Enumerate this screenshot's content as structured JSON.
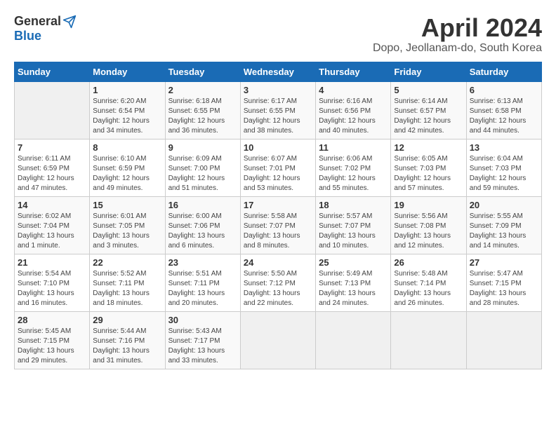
{
  "logo": {
    "general": "General",
    "blue": "Blue"
  },
  "title": "April 2024",
  "subtitle": "Dopo, Jeollanam-do, South Korea",
  "headers": [
    "Sunday",
    "Monday",
    "Tuesday",
    "Wednesday",
    "Thursday",
    "Friday",
    "Saturday"
  ],
  "rows": [
    [
      {
        "day": "",
        "info": ""
      },
      {
        "day": "1",
        "info": "Sunrise: 6:20 AM\nSunset: 6:54 PM\nDaylight: 12 hours\nand 34 minutes."
      },
      {
        "day": "2",
        "info": "Sunrise: 6:18 AM\nSunset: 6:55 PM\nDaylight: 12 hours\nand 36 minutes."
      },
      {
        "day": "3",
        "info": "Sunrise: 6:17 AM\nSunset: 6:55 PM\nDaylight: 12 hours\nand 38 minutes."
      },
      {
        "day": "4",
        "info": "Sunrise: 6:16 AM\nSunset: 6:56 PM\nDaylight: 12 hours\nand 40 minutes."
      },
      {
        "day": "5",
        "info": "Sunrise: 6:14 AM\nSunset: 6:57 PM\nDaylight: 12 hours\nand 42 minutes."
      },
      {
        "day": "6",
        "info": "Sunrise: 6:13 AM\nSunset: 6:58 PM\nDaylight: 12 hours\nand 44 minutes."
      }
    ],
    [
      {
        "day": "7",
        "info": "Sunrise: 6:11 AM\nSunset: 6:59 PM\nDaylight: 12 hours\nand 47 minutes."
      },
      {
        "day": "8",
        "info": "Sunrise: 6:10 AM\nSunset: 6:59 PM\nDaylight: 12 hours\nand 49 minutes."
      },
      {
        "day": "9",
        "info": "Sunrise: 6:09 AM\nSunset: 7:00 PM\nDaylight: 12 hours\nand 51 minutes."
      },
      {
        "day": "10",
        "info": "Sunrise: 6:07 AM\nSunset: 7:01 PM\nDaylight: 12 hours\nand 53 minutes."
      },
      {
        "day": "11",
        "info": "Sunrise: 6:06 AM\nSunset: 7:02 PM\nDaylight: 12 hours\nand 55 minutes."
      },
      {
        "day": "12",
        "info": "Sunrise: 6:05 AM\nSunset: 7:03 PM\nDaylight: 12 hours\nand 57 minutes."
      },
      {
        "day": "13",
        "info": "Sunrise: 6:04 AM\nSunset: 7:03 PM\nDaylight: 12 hours\nand 59 minutes."
      }
    ],
    [
      {
        "day": "14",
        "info": "Sunrise: 6:02 AM\nSunset: 7:04 PM\nDaylight: 13 hours\nand 1 minute."
      },
      {
        "day": "15",
        "info": "Sunrise: 6:01 AM\nSunset: 7:05 PM\nDaylight: 13 hours\nand 3 minutes."
      },
      {
        "day": "16",
        "info": "Sunrise: 6:00 AM\nSunset: 7:06 PM\nDaylight: 13 hours\nand 6 minutes."
      },
      {
        "day": "17",
        "info": "Sunrise: 5:58 AM\nSunset: 7:07 PM\nDaylight: 13 hours\nand 8 minutes."
      },
      {
        "day": "18",
        "info": "Sunrise: 5:57 AM\nSunset: 7:07 PM\nDaylight: 13 hours\nand 10 minutes."
      },
      {
        "day": "19",
        "info": "Sunrise: 5:56 AM\nSunset: 7:08 PM\nDaylight: 13 hours\nand 12 minutes."
      },
      {
        "day": "20",
        "info": "Sunrise: 5:55 AM\nSunset: 7:09 PM\nDaylight: 13 hours\nand 14 minutes."
      }
    ],
    [
      {
        "day": "21",
        "info": "Sunrise: 5:54 AM\nSunset: 7:10 PM\nDaylight: 13 hours\nand 16 minutes."
      },
      {
        "day": "22",
        "info": "Sunrise: 5:52 AM\nSunset: 7:11 PM\nDaylight: 13 hours\nand 18 minutes."
      },
      {
        "day": "23",
        "info": "Sunrise: 5:51 AM\nSunset: 7:11 PM\nDaylight: 13 hours\nand 20 minutes."
      },
      {
        "day": "24",
        "info": "Sunrise: 5:50 AM\nSunset: 7:12 PM\nDaylight: 13 hours\nand 22 minutes."
      },
      {
        "day": "25",
        "info": "Sunrise: 5:49 AM\nSunset: 7:13 PM\nDaylight: 13 hours\nand 24 minutes."
      },
      {
        "day": "26",
        "info": "Sunrise: 5:48 AM\nSunset: 7:14 PM\nDaylight: 13 hours\nand 26 minutes."
      },
      {
        "day": "27",
        "info": "Sunrise: 5:47 AM\nSunset: 7:15 PM\nDaylight: 13 hours\nand 28 minutes."
      }
    ],
    [
      {
        "day": "28",
        "info": "Sunrise: 5:45 AM\nSunset: 7:15 PM\nDaylight: 13 hours\nand 29 minutes."
      },
      {
        "day": "29",
        "info": "Sunrise: 5:44 AM\nSunset: 7:16 PM\nDaylight: 13 hours\nand 31 minutes."
      },
      {
        "day": "30",
        "info": "Sunrise: 5:43 AM\nSunset: 7:17 PM\nDaylight: 13 hours\nand 33 minutes."
      },
      {
        "day": "",
        "info": ""
      },
      {
        "day": "",
        "info": ""
      },
      {
        "day": "",
        "info": ""
      },
      {
        "day": "",
        "info": ""
      }
    ]
  ]
}
